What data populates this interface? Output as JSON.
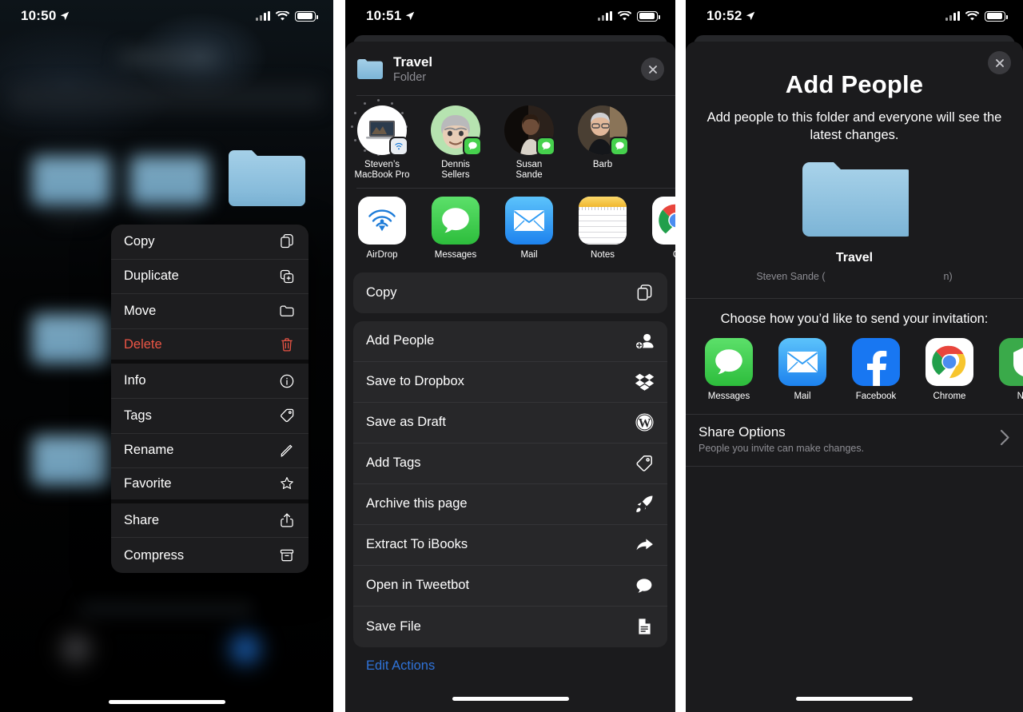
{
  "panels": {
    "one": {
      "status": {
        "time": "10:50"
      },
      "context_menu": {
        "items": [
          {
            "label": "Copy",
            "icon": "copy-icon",
            "danger": false,
            "separator_after": false
          },
          {
            "label": "Duplicate",
            "icon": "duplicate-icon",
            "danger": false,
            "separator_after": false
          },
          {
            "label": "Move",
            "icon": "folder-icon",
            "danger": false,
            "separator_after": false
          },
          {
            "label": "Delete",
            "icon": "trash-icon",
            "danger": true,
            "separator_after": true
          },
          {
            "label": "Info",
            "icon": "info-circle-icon",
            "danger": false,
            "separator_after": false
          },
          {
            "label": "Tags",
            "icon": "tag-icon",
            "danger": false,
            "separator_after": false
          },
          {
            "label": "Rename",
            "icon": "pencil-icon",
            "danger": false,
            "separator_after": false
          },
          {
            "label": "Favorite",
            "icon": "star-icon",
            "danger": false,
            "separator_after": true
          },
          {
            "label": "Share",
            "icon": "share-up-icon",
            "danger": false,
            "separator_after": false
          },
          {
            "label": "Compress",
            "icon": "archive-box-icon",
            "danger": false,
            "separator_after": false
          }
        ]
      }
    },
    "two": {
      "status": {
        "time": "10:51"
      },
      "header": {
        "title": "Travel",
        "subtitle": "Folder",
        "close_icon": "close-icon"
      },
      "people": [
        {
          "name": "Steven’s\nMacBook Pro",
          "badge": "airdrop-icon",
          "avatar": "macbook-photo"
        },
        {
          "name": "Dennis\nSellers",
          "badge": "messages-icon",
          "avatar": "memoji-photo"
        },
        {
          "name": "Susan\nSande",
          "badge": "messages-icon",
          "avatar": "person-photo"
        },
        {
          "name": "Barb",
          "badge": "messages-icon",
          "avatar": "person-photo"
        }
      ],
      "apps": [
        {
          "name": "AirDrop",
          "icon": "airdrop-icon"
        },
        {
          "name": "Messages",
          "icon": "messages-icon"
        },
        {
          "name": "Mail",
          "icon": "mail-icon"
        },
        {
          "name": "Notes",
          "icon": "notes-icon"
        },
        {
          "name": "C",
          "icon": "chrome-icon"
        }
      ],
      "primary_action": {
        "label": "Copy",
        "icon": "copy-icon"
      },
      "actions": [
        {
          "label": "Add People",
          "icon": "add-person-icon"
        },
        {
          "label": "Save to Dropbox",
          "icon": "dropbox-icon"
        },
        {
          "label": "Save as Draft",
          "icon": "wordpress-icon"
        },
        {
          "label": "Add Tags",
          "icon": "tag-icon"
        },
        {
          "label": "Archive this page",
          "icon": "rocket-icon"
        },
        {
          "label": "Extract To iBooks",
          "icon": "arrow-forward-icon"
        },
        {
          "label": "Open in Tweetbot",
          "icon": "speech-bubble-icon"
        },
        {
          "label": "Save File",
          "icon": "document-icon"
        }
      ],
      "edit_actions_label": "Edit Actions"
    },
    "three": {
      "status": {
        "time": "10:52"
      },
      "close_icon": "close-icon",
      "title": "Add People",
      "description": "Add people to this folder and everyone will see the latest changes.",
      "folder_name": "Travel",
      "owner_prefix": "Steven Sande (",
      "owner_suffix": "n)",
      "choose_label": "Choose how you’d like to send your invitation:",
      "apps": [
        {
          "name": "Messages",
          "icon": "messages-icon"
        },
        {
          "name": "Mail",
          "icon": "mail-icon"
        },
        {
          "name": "Facebook",
          "icon": "facebook-icon"
        },
        {
          "name": "Chrome",
          "icon": "chrome-icon"
        },
        {
          "name": "Ne",
          "icon": "green-app-icon"
        }
      ],
      "share_options": {
        "title": "Share Options",
        "subtitle": "People you invite can make changes.",
        "chevron": "chevron-right-icon"
      }
    }
  },
  "colors": {
    "folder_blue": "#8ec5e2",
    "delete_red": "#eb5545",
    "link_blue": "#2f73d9",
    "messages_green": "#46d14d",
    "mail_blue": "#2f9cf4",
    "facebook_blue": "#1877f2",
    "notes_yellow": "#f6c844",
    "sheet_bg": "#1b1b1d",
    "card_bg": "#272729"
  }
}
